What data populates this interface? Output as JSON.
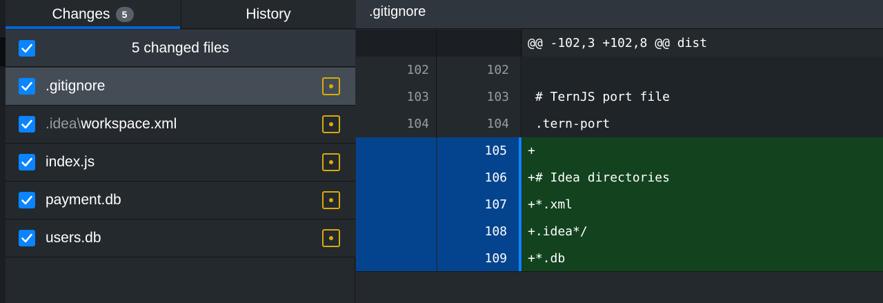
{
  "tabs": {
    "changes_label": "Changes",
    "changes_count": "5",
    "history_label": "History"
  },
  "files_header": {
    "count_label": "5 changed files",
    "all_checked": true
  },
  "files": [
    {
      "dir": "",
      "sep": "",
      "name": ".gitignore",
      "checked": true,
      "selected": true,
      "status": "modified"
    },
    {
      "dir": ".idea",
      "sep": "\\",
      "name": "workspace.xml",
      "checked": true,
      "selected": false,
      "status": "modified"
    },
    {
      "dir": "",
      "sep": "",
      "name": "index.js",
      "checked": true,
      "selected": false,
      "status": "modified"
    },
    {
      "dir": "",
      "sep": "",
      "name": "payment.db",
      "checked": true,
      "selected": false,
      "status": "modified"
    },
    {
      "dir": "",
      "sep": "",
      "name": "users.db",
      "checked": true,
      "selected": false,
      "status": "modified"
    }
  ],
  "diff": {
    "path": ".gitignore",
    "lines": [
      {
        "type": "hunk",
        "old": "",
        "new": "",
        "text": "@@ -102,3 +102,8 @@ dist"
      },
      {
        "type": "context",
        "old": "102",
        "new": "102",
        "text": ""
      },
      {
        "type": "context",
        "old": "103",
        "new": "103",
        "text": " # TernJS port file"
      },
      {
        "type": "context",
        "old": "104",
        "new": "104",
        "text": " .tern-port"
      },
      {
        "type": "added",
        "old": "",
        "new": "105",
        "text": "+"
      },
      {
        "type": "added",
        "old": "",
        "new": "106",
        "text": "+# Idea directories"
      },
      {
        "type": "added",
        "old": "",
        "new": "107",
        "text": "+*.xml"
      },
      {
        "type": "added",
        "old": "",
        "new": "108",
        "text": "+.idea*/"
      },
      {
        "type": "added",
        "old": "",
        "new": "109",
        "text": "+*.db"
      }
    ]
  },
  "colors": {
    "accent_blue": "#0366d6",
    "checkbox_blue": "#0a84ff",
    "modified_yellow": "#dbab09",
    "added_line_bg": "#12421e",
    "added_gutter_bg": "#04448f"
  },
  "icons": {
    "checkbox": "checkmark-icon",
    "file_status": "file-modified-icon"
  }
}
